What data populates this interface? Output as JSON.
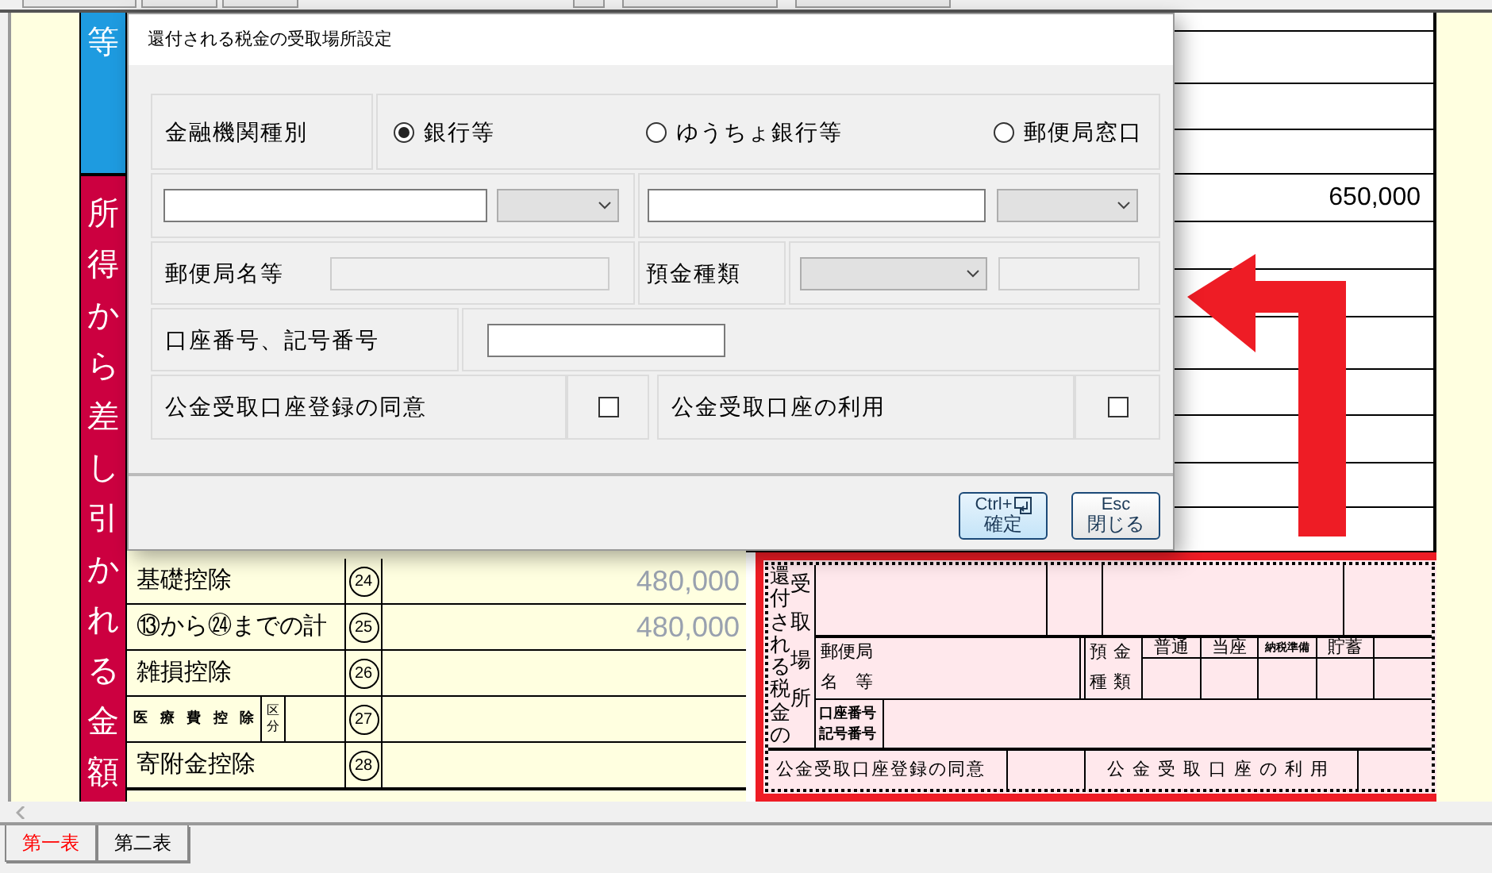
{
  "form": {
    "side_labels": [
      {
        "text": "等",
        "color": "#1e9be0"
      },
      {
        "text": "所得から差し引かれる金額",
        "color": "#cc0040"
      }
    ],
    "upper_value": "650,000",
    "rows": [
      {
        "kind": "plain",
        "label": "基礎控除",
        "number": "24",
        "value": "480,000"
      },
      {
        "kind": "plain",
        "label": "⑬から㉔までの計",
        "number": "25",
        "value": "480,000"
      },
      {
        "kind": "plain",
        "label": "雑損控除",
        "number": "26"
      },
      {
        "kind": "split",
        "label": "医療費控除",
        "sub_label": "区分",
        "number": "27"
      },
      {
        "kind": "plain",
        "label": "寄附金控除",
        "number": "28"
      }
    ],
    "refund_box": {
      "side_label": "還付される税金の",
      "side_label_2": "受取場所",
      "post_office_label": "郵便局",
      "post_office_label_2": "名　等",
      "deposit_label": "預金",
      "deposit_label_2": "種類",
      "deposit_types": [
        "普通",
        "当座",
        "納税準備",
        "貯蓄"
      ],
      "account_label": "口座番号",
      "account_label_2": "記号番号",
      "consent_label": "公金受取口座登録の同意",
      "usage_label": "公金受取口座の利用"
    }
  },
  "dialog": {
    "title": "還付される税金の受取場所設定",
    "institution_label": "金融機関種別",
    "institution_options": [
      {
        "label": "銀行等",
        "selected": true
      },
      {
        "label": "ゆうちょ銀行等",
        "selected": false
      },
      {
        "label": "郵便局窓口",
        "selected": false
      }
    ],
    "post_office_name_label": "郵便局名等",
    "post_office_name_field": {
      "disabled": true
    },
    "deposit_type_label": "預金種類",
    "deposit_number_field": {
      "disabled": true
    },
    "account_label": "口座番号、記号番号",
    "consent": {
      "label": "公金受取口座登録の同意",
      "checked": false
    },
    "usage": {
      "label": "公金受取口座の利用",
      "checked": false
    },
    "buttons": [
      {
        "kind": "confirm",
        "key": "Ctrl+",
        "label": "確定"
      },
      {
        "kind": "close",
        "key": "Esc",
        "label": "閉じる"
      }
    ]
  },
  "sheet_tabs": [
    {
      "label": "第一表",
      "selected": true
    },
    {
      "label": "第二表",
      "selected": false
    }
  ]
}
